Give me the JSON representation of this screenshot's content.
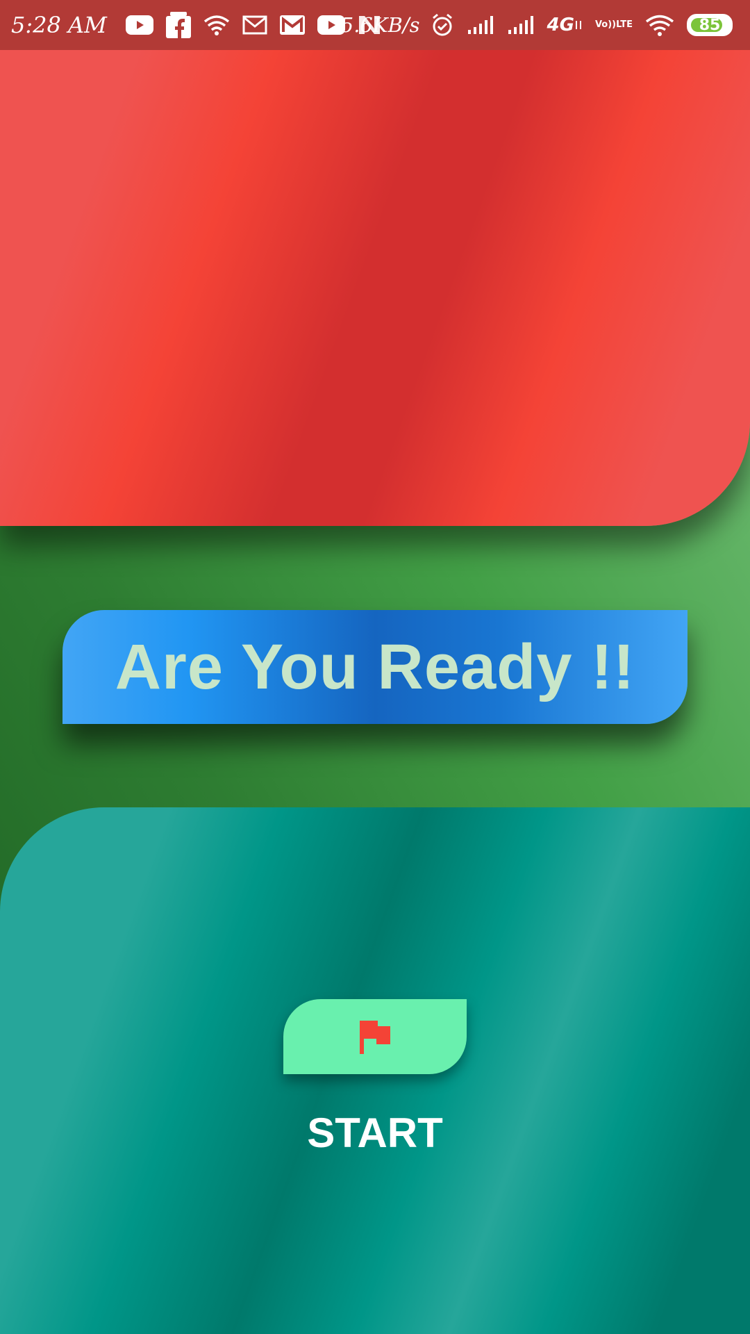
{
  "status_bar": {
    "time": "5:28 AM",
    "left_icons": [
      "youtube-icon",
      "facebook-icon",
      "wifi-icon",
      "mail-icon",
      "gmail-icon",
      "youtube-icon",
      "news-icon"
    ],
    "speed": "5.6KB/s",
    "network_type": "4G",
    "volte_top": "Vo))",
    "volte_bottom": "LTE",
    "battery_level": "85",
    "battery_fraction": 0.85,
    "background_color": "#b23a36"
  },
  "banner": {
    "title": "Are You Ready !!"
  },
  "start": {
    "icon": "flag-icon",
    "label": "START"
  },
  "colors": {
    "top_panel": "#f44336",
    "banner": "#1976d2",
    "banner_text": "#c8e6c9",
    "bottom_panel": "#009688",
    "start_button": "#69f0ae",
    "flag": "#f44336"
  }
}
